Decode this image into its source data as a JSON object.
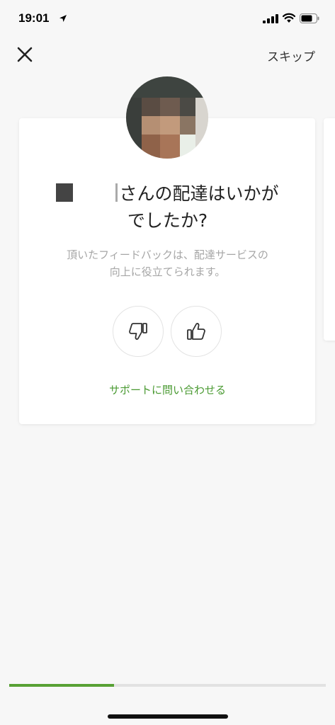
{
  "status_bar": {
    "time": "19:01",
    "icons": [
      "location-arrow-icon",
      "cellular-signal-icon",
      "wifi-icon",
      "battery-icon"
    ]
  },
  "nav": {
    "close_icon": "close-icon",
    "skip_label": "スキップ"
  },
  "card": {
    "headline_line1_rest": "さんの配達はいかが",
    "headline_line2": "でしたか?",
    "subtext_line1": "頂いたフィードバックは、配達サービスの",
    "subtext_line2": "向上に役立てられます。",
    "thumbs_down_icon": "thumbs-down-icon",
    "thumbs_up_icon": "thumbs-up-icon",
    "support_label": "サポートに問い合わせる"
  },
  "progress": {
    "fraction": 0.33
  },
  "colors": {
    "accent": "#4a9a32",
    "progress_fill": "#58a135",
    "background": "#f7f7f7",
    "subtext": "#a6a6a6"
  }
}
